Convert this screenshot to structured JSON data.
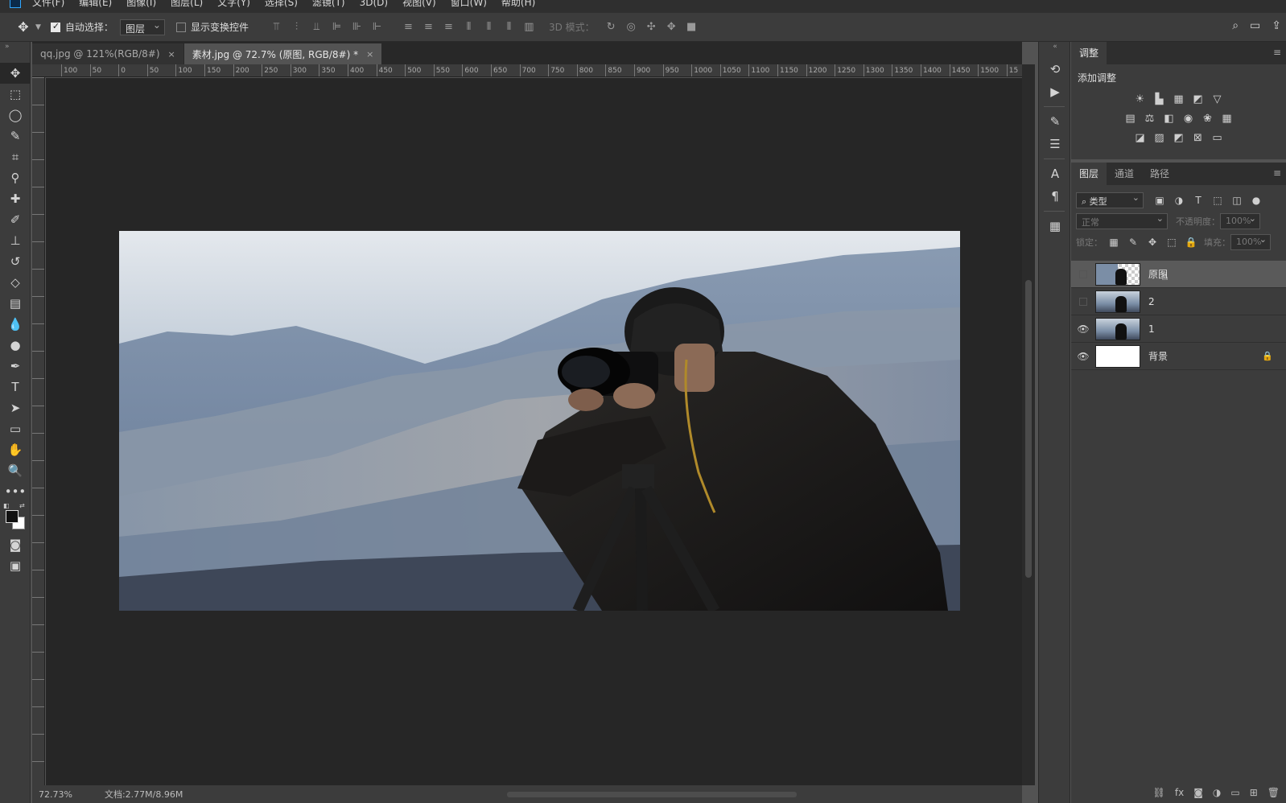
{
  "menu": [
    "文件(F)",
    "编辑(E)",
    "图像(I)",
    "图层(L)",
    "文字(Y)",
    "选择(S)",
    "滤镜(T)",
    "3D(D)",
    "视图(V)",
    "窗口(W)",
    "帮助(H)"
  ],
  "options": {
    "auto_select_label": "自动选择：",
    "auto_select_value": "图层",
    "show_transform_label": "显示变换控件",
    "mode_3d_label": "3D 模式："
  },
  "tabs": [
    {
      "label": "qq.jpg @ 121%(RGB/8#)",
      "close": "×"
    },
    {
      "label": "素材.jpg @ 72.7% (原图, RGB/8#) *",
      "close": "×"
    }
  ],
  "ruler_h": [
    "100",
    "50",
    "0",
    "50",
    "100",
    "150",
    "200",
    "250",
    "300",
    "350",
    "400",
    "450",
    "500",
    "550",
    "600",
    "650",
    "700",
    "750",
    "800",
    "850",
    "900",
    "950",
    "1000",
    "1050",
    "1100",
    "1150",
    "1200",
    "1250",
    "1300",
    "1350",
    "1400",
    "1450",
    "1500",
    "15"
  ],
  "status": {
    "zoom": "72.73%",
    "doc": "文档:2.77M/8.96M"
  },
  "adjust_panel": {
    "tab": "调整",
    "title": "添加调整"
  },
  "layers_panel": {
    "tabs": [
      "图层",
      "通道",
      "路径"
    ],
    "filter": "类型",
    "blend": "正常",
    "opacity_label": "不透明度：",
    "opacity_value": "100%",
    "lock_label": "锁定：",
    "fill_label": "填充：",
    "fill_value": "100%",
    "layers": [
      {
        "name": "原图",
        "visible": false,
        "selected": true
      },
      {
        "name": "2",
        "visible": false,
        "selected": false
      },
      {
        "name": "1",
        "visible": true,
        "selected": false
      },
      {
        "name": "背景",
        "visible": true,
        "selected": false,
        "locked": true
      }
    ]
  },
  "colors": {
    "foreground": "#111111",
    "background": "#ffffff",
    "ps_blue": "#31a8ff"
  }
}
